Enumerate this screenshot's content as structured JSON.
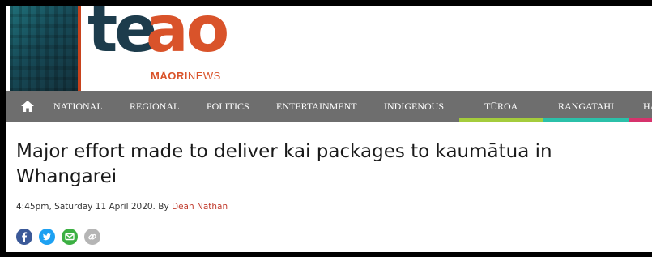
{
  "logo": {
    "te": "te",
    "ao": "ao",
    "sub_a": "MĀORI",
    "sub_b": "NEWS"
  },
  "nav": {
    "home_icon": "home-icon",
    "items": [
      {
        "label": "NATIONAL"
      },
      {
        "label": "REGIONAL"
      },
      {
        "label": "POLITICS"
      },
      {
        "label": "ENTERTAINMENT"
      },
      {
        "label": "INDIGENOUS"
      },
      {
        "label": "TŪROA",
        "accent": "#a4cc3c"
      },
      {
        "label": "RANGATAHI",
        "accent": "#2bc0a9"
      },
      {
        "label": "HA",
        "accent": "#d6336c"
      }
    ]
  },
  "article": {
    "title": "Major effort made to deliver kai packages to kaumātua in Whangarei",
    "meta": "4:45pm, Saturday 11 April 2020. By ",
    "author": "Dean Nathan"
  },
  "share": [
    {
      "icon": "facebook-icon",
      "color": "#3b5998"
    },
    {
      "icon": "twitter-icon",
      "color": "#1da1f2"
    },
    {
      "icon": "email-icon",
      "color": "#3cb043"
    },
    {
      "icon": "link-icon",
      "color": "#b5b5b5"
    }
  ]
}
